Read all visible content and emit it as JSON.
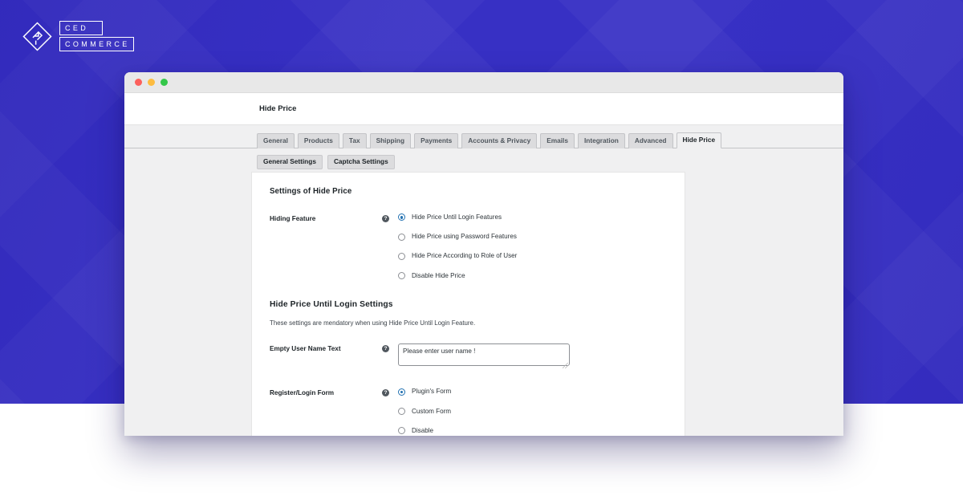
{
  "brand": {
    "logo_line1": "CED",
    "logo_line2": "COMMERCE",
    "logo_mark_name": "ced-commerce-diamond-logo",
    "background_color": "#3730c4"
  },
  "window": {
    "traffic_lights": [
      {
        "name": "close",
        "color": "#fc605c"
      },
      {
        "name": "minimize",
        "color": "#fdbc40"
      },
      {
        "name": "maximize",
        "color": "#34c749"
      }
    ],
    "admin_title": "Hide Price"
  },
  "tabs": {
    "items": [
      {
        "label": "General",
        "active": false
      },
      {
        "label": "Products",
        "active": false
      },
      {
        "label": "Tax",
        "active": false
      },
      {
        "label": "Shipping",
        "active": false
      },
      {
        "label": "Payments",
        "active": false
      },
      {
        "label": "Accounts & Privacy",
        "active": false
      },
      {
        "label": "Emails",
        "active": false
      },
      {
        "label": "Integration",
        "active": false
      },
      {
        "label": "Advanced",
        "active": false
      },
      {
        "label": "Hide Price",
        "active": true
      }
    ]
  },
  "subtabs": {
    "items": [
      {
        "label": "General Settings",
        "active": true
      },
      {
        "label": "Captcha Settings",
        "active": false
      }
    ]
  },
  "settings": {
    "section_title": "Settings of Hide Price",
    "hiding_feature": {
      "label": "Hiding Feature",
      "help": "?",
      "options": [
        {
          "label": "Hide Price Until Login Features",
          "checked": true
        },
        {
          "label": "Hide Price using Password Features",
          "checked": false
        },
        {
          "label": "Hide Price According to Role of User",
          "checked": false
        },
        {
          "label": "Disable Hide Price",
          "checked": false
        }
      ]
    },
    "login_section": {
      "title": "Hide Price Until Login Settings",
      "description": "These settings are mendatory when using Hide Price Until Login Feature."
    },
    "empty_user_name": {
      "label": "Empty User Name Text",
      "help": "?",
      "value": "Please enter user name !"
    },
    "register_login_form": {
      "label": "Register/Login Form",
      "help": "?",
      "options": [
        {
          "label": "Plugin's Form",
          "checked": true
        },
        {
          "label": "Custom Form",
          "checked": false
        },
        {
          "label": "Disable",
          "checked": false
        }
      ]
    }
  }
}
